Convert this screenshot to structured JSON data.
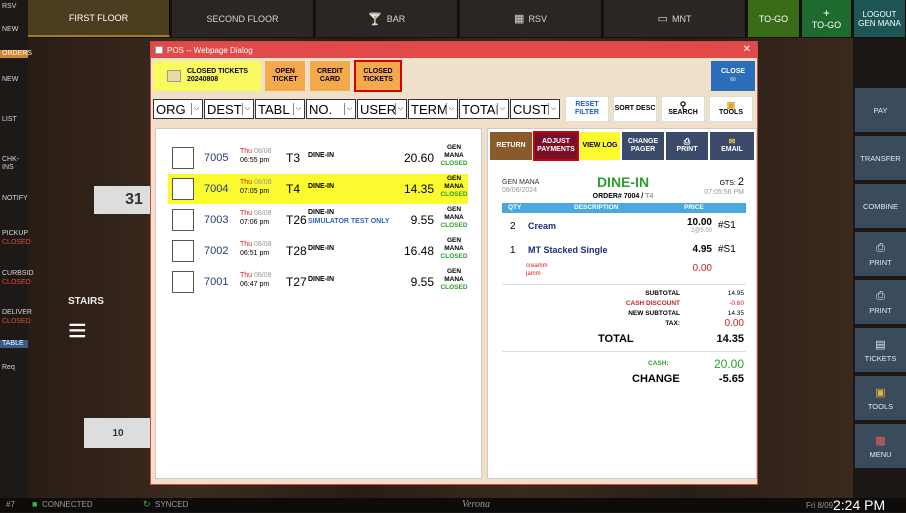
{
  "topnav": {
    "first_floor": "FIRST FLOOR",
    "second_floor": "SECOND FLOOR",
    "bar": "BAR",
    "rsv": "RSV",
    "mnt": "MNT",
    "to_go": "TO-GO",
    "to_go_add": "TO-GO",
    "logout": "LOGOUT",
    "logout_user": "GEN MANA"
  },
  "leftbar": {
    "rsv": "RSV",
    "new1": "NEW",
    "orders": "ORDERS",
    "new2": "NEW",
    "list": "LIST",
    "chkins": "CHK-INS",
    "notify": "NOTIFY",
    "pickup": "PICKUP",
    "pickup_s": "CLOSED",
    "curbside": "CURBSID",
    "curbside_s": "CLOSED",
    "deliver": "DELIVER",
    "deliver_s": "CLOSED",
    "table": "TABLE",
    "req": "Req"
  },
  "floor": {
    "table_31": "31",
    "stairs": "STAIRS",
    "table_10": "10"
  },
  "rightbar": [
    "PAY",
    "TRANSFER",
    "COMBINE",
    "PRINT",
    "PRINT",
    "TICKETS",
    "TOOLS",
    "MENU"
  ],
  "bottom": {
    "left": "#7",
    "connected": "CONNECTED",
    "synced": "SYNCED",
    "center": "Verona",
    "date": "Fri 8/09",
    "time": "2:24 PM"
  },
  "dialog": {
    "title": "POS -- Webpage Dialog",
    "close_x": "✕",
    "closed_tickets_title": "CLOSED TICKETS",
    "closed_tickets_date": "20240808",
    "tabs": [
      "OPEN TICKET",
      "CREDIT CARD",
      "CLOSED TICKETS"
    ],
    "close_btn": "CLOSE",
    "close_sub": "60",
    "filters": [
      "ORG",
      "DEST",
      "TABL",
      "NO.",
      "USER",
      "TERM",
      "TOTAI",
      "CUST"
    ],
    "reset": "RESET FILTER",
    "sort": "SORT DESC",
    "search": "SEARCH",
    "tools": "TOOLS",
    "rows": [
      {
        "no": "7005",
        "day": "Thu",
        "date": "08/08",
        "time": "06:55 pm",
        "table": "T3",
        "type": "DINE-IN",
        "sub": "",
        "amount": "20.60",
        "user1": "GEN",
        "user2": "MANA",
        "status": "CLOSED"
      },
      {
        "no": "7004",
        "day": "Thu",
        "date": "08/08",
        "time": "07:05 pm",
        "table": "T4",
        "type": "DINE-IN",
        "sub": "",
        "amount": "14.35",
        "user1": "GEN",
        "user2": "MANA",
        "status": "CLOSED"
      },
      {
        "no": "7003",
        "day": "Thu",
        "date": "08/08",
        "time": "07:06 pm",
        "table": "T26",
        "type": "DINE-IN",
        "sub": "SIMULATOR TEST ONLY",
        "amount": "9.55",
        "user1": "GEN",
        "user2": "MANA",
        "status": "CLOSED"
      },
      {
        "no": "7002",
        "day": "Thu",
        "date": "08/08",
        "time": "06:51 pm",
        "table": "T28",
        "type": "DINE-IN",
        "sub": "",
        "amount": "16.48",
        "user1": "GEN",
        "user2": "MANA",
        "status": "CLOSED"
      },
      {
        "no": "7001",
        "day": "Thu",
        "date": "08/08",
        "time": "06:47 pm",
        "table": "T27",
        "type": "DINE-IN",
        "sub": "",
        "amount": "9.55",
        "user1": "GEN",
        "user2": "MANA",
        "status": "CLOSED"
      }
    ],
    "actions": {
      "return": "RETURN",
      "adjust": "ADJUST PAYMENTS",
      "viewlog": "VIEW LOG",
      "change_pager": "CHANGE PAGER",
      "print": "PRINT",
      "email": "EMAIL"
    },
    "receipt": {
      "user": "GEN MANA",
      "date": "08/08/2024",
      "type": "DINE-IN",
      "order": "ORDER# 7004 / ",
      "order_table": "T4",
      "gts_label": "GTS:",
      "gts": "2",
      "time": "07:05:56 PM",
      "col_qty": "QTY",
      "col_desc": "DESCRIPTION",
      "col_price": "PRICE",
      "items": [
        {
          "qty": "2",
          "name": "Cream",
          "price": "10.00",
          "sub": "2@5.00",
          "seat": "#S1"
        },
        {
          "qty": "1",
          "name": "MT Stacked Single",
          "price": "4.95",
          "sub": "",
          "seat": "#S1"
        }
      ],
      "mods": [
        "creamm",
        "jamm"
      ],
      "mods_price": "0.00",
      "subtotal_l": "SUBTOTAL",
      "subtotal": "14.95",
      "discount_l": "CASH DISCOUNT",
      "discount": "-0.60",
      "newsub_l": "NEW SUBTOTAL",
      "newsub": "14.35",
      "tax_l": "TAX:",
      "tax": "0.00",
      "total_l": "TOTAL",
      "total": "14.35",
      "cash_l": "CASH:",
      "cash": "20.00",
      "change_l": "CHANGE",
      "change": "-5.65"
    }
  }
}
